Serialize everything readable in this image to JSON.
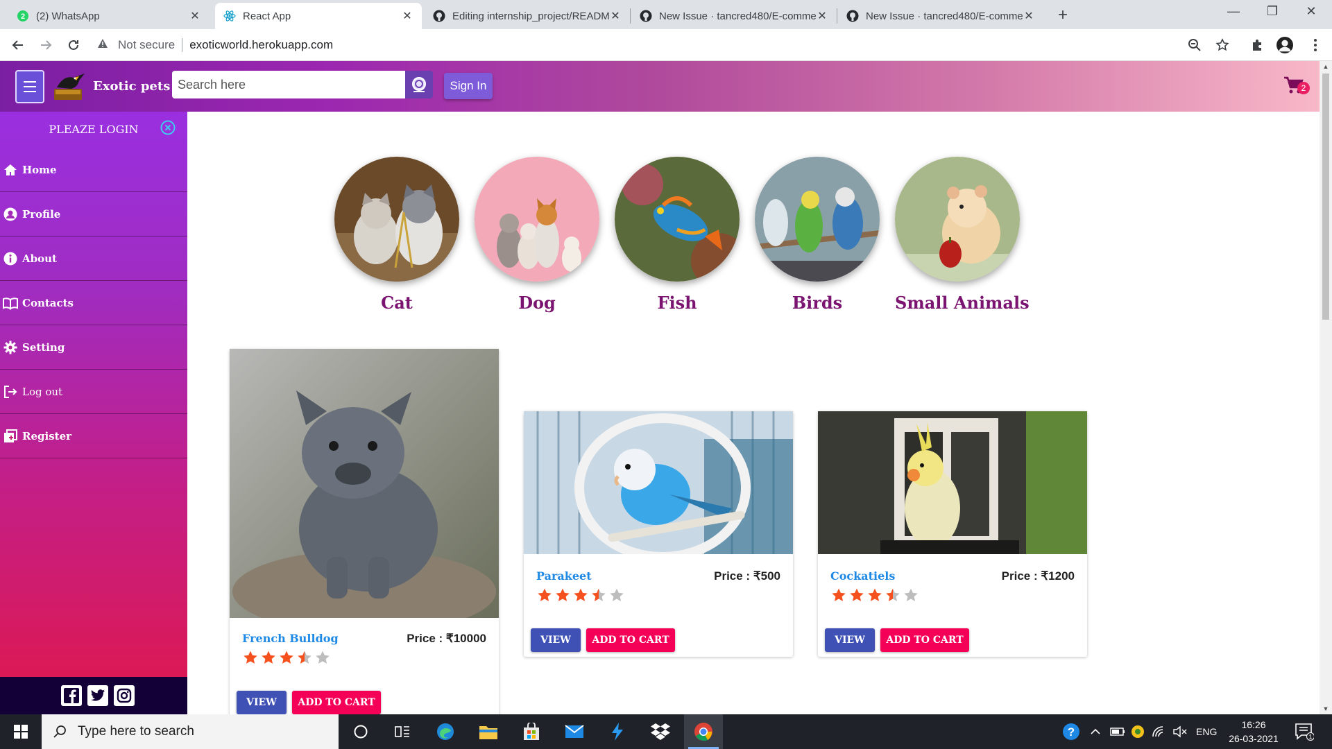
{
  "browser": {
    "tabs": [
      {
        "title": "(2) WhatsApp",
        "icon": "whatsapp-icon"
      },
      {
        "title": "React App",
        "icon": "react-icon"
      },
      {
        "title": "Editing internship_project/READM",
        "icon": "github-icon"
      },
      {
        "title": "New Issue · tancred480/E-comme",
        "icon": "github-icon"
      },
      {
        "title": "New Issue · tancred480/E-comme",
        "icon": "github-icon"
      }
    ],
    "security_label": "Not secure",
    "url": "exoticworld.herokuapp.com"
  },
  "header": {
    "brand": "Exotic pets",
    "search_placeholder": "Search here",
    "signin_label": "Sign In",
    "cart_count": "2"
  },
  "sidebar": {
    "login_prompt": "PLEAZE LOGIN",
    "items": [
      {
        "label": "Home",
        "icon": "home-icon"
      },
      {
        "label": "Profile",
        "icon": "user-icon"
      },
      {
        "label": "About",
        "icon": "info-icon"
      },
      {
        "label": "Contacts",
        "icon": "book-icon"
      },
      {
        "label": "Setting",
        "icon": "gear-icon"
      },
      {
        "label": "Log out",
        "icon": "logout-icon"
      },
      {
        "label": "Register",
        "icon": "register-icon"
      }
    ],
    "social": [
      "facebook-icon",
      "twitter-icon",
      "instagram-icon"
    ]
  },
  "categories": [
    "Cat",
    "Dog",
    "Fish",
    "Birds",
    "Small Animals"
  ],
  "products": [
    {
      "name": "French Bulldog",
      "price": "Price : ₹10000",
      "rating": 3.5,
      "view_label": "VIEW",
      "cart_label": "ADD TO CART"
    },
    {
      "name": "Parakeet",
      "price": "Price : ₹500",
      "rating": 3.5,
      "view_label": "VIEW",
      "cart_label": "ADD TO CART"
    },
    {
      "name": "Cockatiels",
      "price": "Price : ₹1200",
      "rating": 3.5,
      "view_label": "VIEW",
      "cart_label": "ADD TO CART"
    }
  ],
  "taskbar": {
    "search_placeholder": "Type here to search",
    "language": "ENG",
    "time": "16:26",
    "date": "26-03-2021",
    "notification_count": "1"
  },
  "colors": {
    "accent": "#9c27b0",
    "category_label": "#7a1470",
    "product_name": "#1e88e5",
    "view_button": "#3f51b5",
    "cart_button": "#f50057",
    "star_filled": "#f4511e",
    "star_empty": "#bdbdbd"
  }
}
